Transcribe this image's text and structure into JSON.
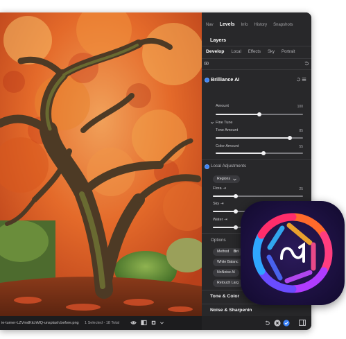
{
  "panel": {
    "tabs": [
      "Nav",
      "Levels",
      "Info",
      "History",
      "Snapshots"
    ],
    "active_tab": "Levels",
    "layers_title": "Layers",
    "module_tabs": [
      "Develop",
      "Local",
      "Effects",
      "Sky",
      "Portrait"
    ],
    "active_module_tab": "Develop",
    "brilliance": {
      "title": "Brilliance AI",
      "amount_label": "Amount",
      "amount_value": "100",
      "amount_level": 0.5,
      "fine_tune_label": "Fine Tune",
      "tone_amount_label": "Tone Amount",
      "tone_amount_value": "85",
      "tone_amount_level": 0.85,
      "color_amount_label": "Color Amount",
      "color_amount_value": "55",
      "color_amount_level": 0.55
    },
    "local_adjustments": {
      "title": "Local Adjustments",
      "dropdown": "Regions",
      "flora_label": "Flora",
      "flora_value": "25",
      "flora_level": 0.25,
      "sky_label": "Sky",
      "sky_value": "25",
      "sky_level": 0.25,
      "water_label": "Water",
      "water_value": "25",
      "water_level": 0.25
    },
    "options": {
      "title": "Options",
      "method_label": "Method",
      "method_value": "Bri",
      "white_balance": "White Balanc",
      "nonoise": "NoNoise AI",
      "retouch": "Retouch Larg"
    },
    "tone_color_title": "Tone & Color",
    "noise_title": "Noise & Sharpenin"
  },
  "statusbar": {
    "filename": "ie-turner-LZVmdKtchMQ-unsplash.before.png",
    "selection": "1 Selected - 18 Total"
  },
  "icons": [
    "eye-icon",
    "compare-icon",
    "crop-icon",
    "check-icon",
    "undo-icon",
    "close-icon",
    "sidebar-icon"
  ],
  "colors": {
    "panel_bg": "#28282a",
    "accent": "#3b82f6",
    "autumn_orange": "#e5672a"
  }
}
